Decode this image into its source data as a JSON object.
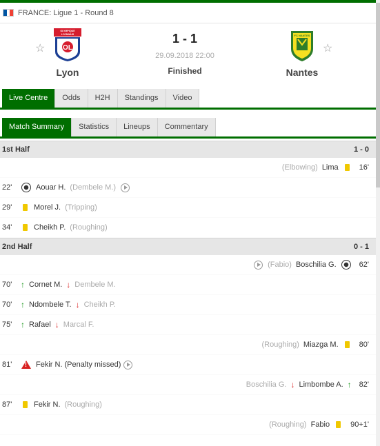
{
  "league": {
    "country": "FRANCE",
    "name": "Ligue 1 - Round 8",
    "text": "FRANCE: Ligue 1 - Round 8",
    "flag_colors": [
      "#0055a4",
      "#ffffff",
      "#ef4135"
    ]
  },
  "match": {
    "home": {
      "name": "Lyon",
      "crest_text": "OLYMPIQUE LYONNAIS"
    },
    "away": {
      "name": "Nantes",
      "crest_text": "FC NANTES"
    },
    "score": "1 - 1",
    "datetime": "29.09.2018 22:00",
    "status": "Finished",
    "favorite_icon": "star-outline-icon"
  },
  "main_tabs": [
    "Live Centre",
    "Odds",
    "H2H",
    "Standings",
    "Video"
  ],
  "sub_tabs": [
    "Match Summary",
    "Statistics",
    "Lineups",
    "Commentary"
  ],
  "first_half": {
    "title": "1st Half",
    "score": "1 - 0",
    "incidents": [
      {
        "side": "away",
        "type": "yellow-card",
        "minute": "16'",
        "player": "Lima",
        "note": "(Elbowing)"
      },
      {
        "side": "home",
        "type": "goal",
        "minute": "22'",
        "player": "Aouar H.",
        "assist": "(Dembele M.)"
      },
      {
        "side": "home",
        "type": "yellow-card",
        "minute": "29'",
        "player": "Morel J.",
        "note": "(Tripping)"
      },
      {
        "side": "home",
        "type": "yellow-card",
        "minute": "34'",
        "player": "Cheikh P.",
        "note": "(Roughing)"
      }
    ]
  },
  "second_half": {
    "title": "2nd Half",
    "score": "0 - 1",
    "incidents": [
      {
        "side": "away",
        "type": "goal",
        "minute": "62'",
        "player": "Boschilia G.",
        "assist": "(Fabio)"
      },
      {
        "side": "home",
        "type": "substitution",
        "minute": "70'",
        "in": "Cornet M.",
        "out": "Dembele M."
      },
      {
        "side": "home",
        "type": "substitution",
        "minute": "70'",
        "in": "Ndombele T.",
        "out": "Cheikh P."
      },
      {
        "side": "home",
        "type": "substitution",
        "minute": "75'",
        "in": "Rafael",
        "out": "Marcal F."
      },
      {
        "side": "away",
        "type": "yellow-card",
        "minute": "80'",
        "player": "Miazga M.",
        "note": "(Roughing)"
      },
      {
        "side": "home",
        "type": "penalty-missed",
        "minute": "81'",
        "player": "Fekir N.",
        "note": "(Penalty missed)"
      },
      {
        "side": "away",
        "type": "substitution",
        "minute": "82'",
        "in": "Limbombe A.",
        "out": "Boschilia G."
      },
      {
        "side": "home",
        "type": "yellow-card",
        "minute": "87'",
        "player": "Fekir N.",
        "note": "(Roughing)"
      },
      {
        "side": "away",
        "type": "yellow-card",
        "minute": "90+1'",
        "player": "Fabio",
        "note": "(Roughing)"
      }
    ]
  },
  "colors": {
    "accent": "#006e00",
    "yellow_card": "#f0c800",
    "sub_in": "#2a9d2a",
    "sub_out": "#d82020"
  }
}
